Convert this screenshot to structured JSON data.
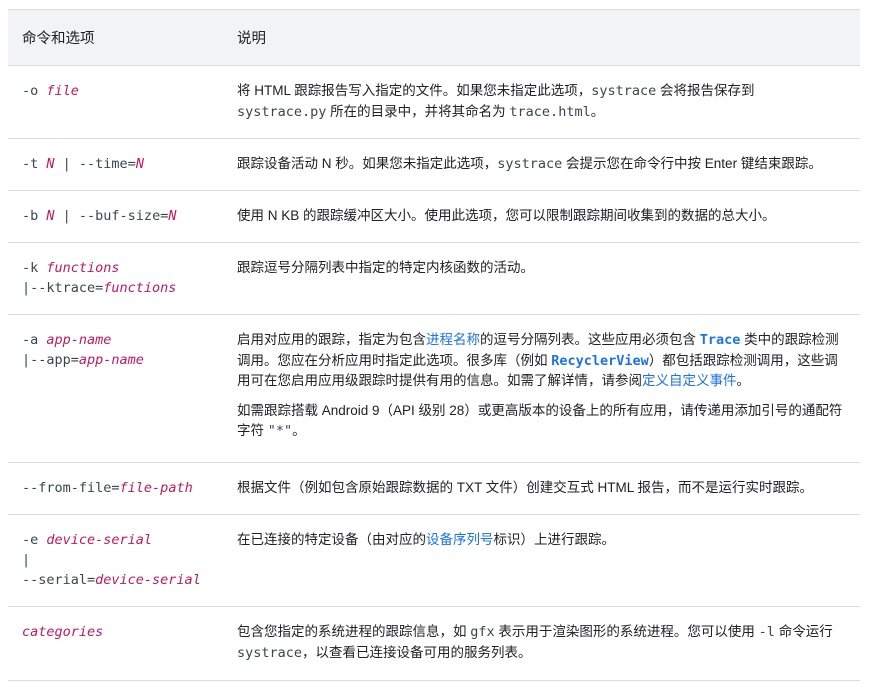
{
  "header": {
    "col1": "命令和选项",
    "col2": "说明"
  },
  "rows": [
    {
      "opt": {
        "a": "-o ",
        "b": "file"
      },
      "desc": {
        "a": "将 HTML 跟踪报告写入指定的文件。如果您未指定此选项，",
        "b": "systrace",
        "c": " 会将报告保存到 ",
        "d": "systrace.py",
        "e": " 所在的目录中，并将其命名为 ",
        "f": "trace.html",
        "g": "。"
      }
    },
    {
      "opt": {
        "a": "-t ",
        "b": "N",
        "c": " | --time=",
        "d": "N"
      },
      "desc": {
        "a": "跟踪设备活动 N 秒。如果您未指定此选项，",
        "b": "systrace",
        "c": " 会提示您在命令行中按 Enter 键结束跟踪。"
      }
    },
    {
      "opt": {
        "a": "-b ",
        "b": "N",
        "c": " | --buf-size=",
        "d": "N"
      },
      "desc": {
        "a": "使用 N KB 的跟踪缓冲区大小。使用此选项，您可以限制跟踪期间收集到的数据的总大小。"
      }
    },
    {
      "opt": {
        "a": "-k ",
        "b": "functions",
        "c": "|--ktrace=",
        "d": "functions"
      },
      "desc": {
        "a": "跟踪逗号分隔列表中指定的特定内核函数的活动。"
      }
    },
    {
      "opt": {
        "a": "-a ",
        "b": "app-name",
        "c": "|--app=",
        "d": "app-name"
      },
      "desc": {
        "a": "启用对应用的跟踪，指定为包含",
        "b": "进程名称",
        "c": "的逗号分隔列表。这些应用必须包含 ",
        "d": "Trace",
        "e": " 类中的跟踪检测调用。您应在分析应用时指定此选项。很多库（例如 ",
        "f": "RecyclerView",
        "g": "）都包括跟踪检测调用，这些调用可在您启用应用级跟踪时提供有用的信息。如需了解详情，请参阅",
        "h": "定义自定义事件",
        "i": "。"
      },
      "desc2": {
        "a": "如需跟踪搭载 Android 9（API 级别 28）或更高版本的设备上的所有应用，请传递用添加引号的通配符字符 ",
        "b": "\"*\"",
        "c": "。"
      }
    },
    {
      "opt": {
        "a": "--from-file=",
        "b": "file-path"
      },
      "desc": {
        "a": "根据文件（例如包含原始跟踪数据的 TXT 文件）创建交互式 HTML 报告，而不是运行实时跟踪。"
      }
    },
    {
      "opt": {
        "a": "-e ",
        "b": "device-serial",
        "c": "|",
        "d": "--serial=",
        "e": "device-serial"
      },
      "desc": {
        "a": "在已连接的特定设备（由对应的",
        "b": "设备序列号",
        "c": "标识）上进行跟踪。"
      }
    },
    {
      "opt": {
        "a": "categories"
      },
      "desc": {
        "a": "包含您指定的系统进程的跟踪信息，如 ",
        "b": "gfx",
        "c": " 表示用于渲染图形的系统进程。您可以使用 ",
        "d": "-l",
        "e": " 命令运行 ",
        "f": "systrace",
        "g": "，以查看已连接设备可用的服务列表。"
      }
    }
  ]
}
